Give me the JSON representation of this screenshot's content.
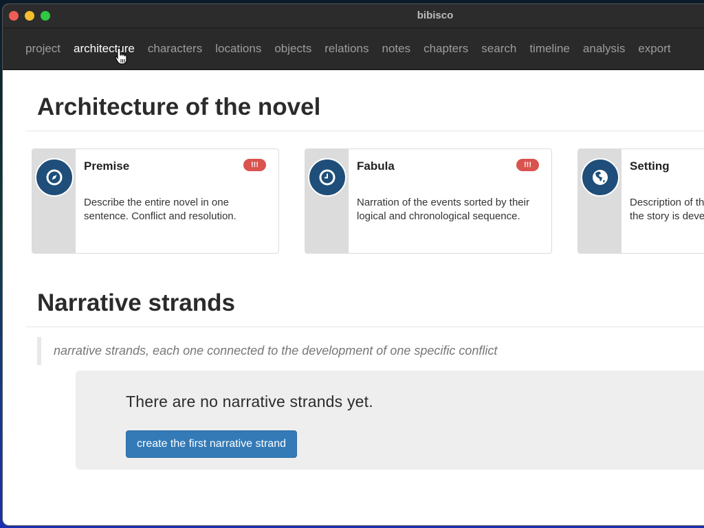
{
  "window": {
    "title": "bibisco",
    "controls": [
      "close",
      "minimize",
      "maximize"
    ]
  },
  "navbar": {
    "items": [
      {
        "label": "project",
        "active": false
      },
      {
        "label": "architecture",
        "active": true
      },
      {
        "label": "characters",
        "active": false
      },
      {
        "label": "locations",
        "active": false
      },
      {
        "label": "objects",
        "active": false
      },
      {
        "label": "relations",
        "active": false
      },
      {
        "label": "notes",
        "active": false
      },
      {
        "label": "chapters",
        "active": false
      },
      {
        "label": "search",
        "active": false
      },
      {
        "label": "timeline",
        "active": false
      },
      {
        "label": "analysis",
        "active": false
      },
      {
        "label": "export",
        "active": false
      }
    ]
  },
  "architecture": {
    "title": "Architecture of the novel",
    "cards": [
      {
        "title": "Premise",
        "icon": "compass-icon",
        "badge": "!!!",
        "description": "Describe the entire novel in one sentence. Conflict and resolution."
      },
      {
        "title": "Fabula",
        "icon": "clock-icon",
        "badge": "!!!",
        "description": "Narration of the events sorted by their logical and chronological sequence."
      },
      {
        "title": "Setting",
        "icon": "globe-icon",
        "badge": "",
        "description": "Description of the social context where the story is developed."
      }
    ]
  },
  "narrative_strands": {
    "title": "Narrative strands",
    "description": "narrative strands, each one connected to the development of one specific conflict",
    "empty_message": "There are no narrative strands yet.",
    "create_button": "create the first narrative strand"
  },
  "colors": {
    "navbar_bg": "#2a2a2a",
    "icon_circle": "#1e4e79",
    "badge_danger": "#d9534f",
    "primary_button": "#337ab7"
  }
}
